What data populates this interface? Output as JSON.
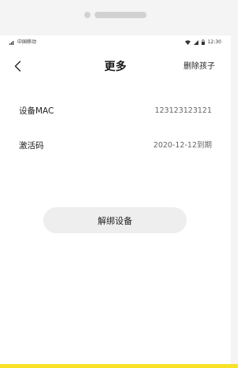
{
  "status_bar": {
    "carrier": "中国移动",
    "time": "12:30"
  },
  "header": {
    "title": "更多",
    "delete_label": "删除孩子"
  },
  "rows": [
    {
      "label": "设备MAC",
      "value": "123123123121"
    },
    {
      "label": "激活码",
      "value": "2020-12-12到期"
    }
  ],
  "unbind_label": "解绑设备",
  "colors": {
    "accent_edge": "#f7e226",
    "frame": "#f4f4f4",
    "button_bg": "#eeeeee"
  },
  "icons": {
    "back": "chevron-left-icon",
    "signal": "signal-icon",
    "wifi": "wifi-icon",
    "battery": "battery-icon",
    "lock": "lock-icon"
  }
}
